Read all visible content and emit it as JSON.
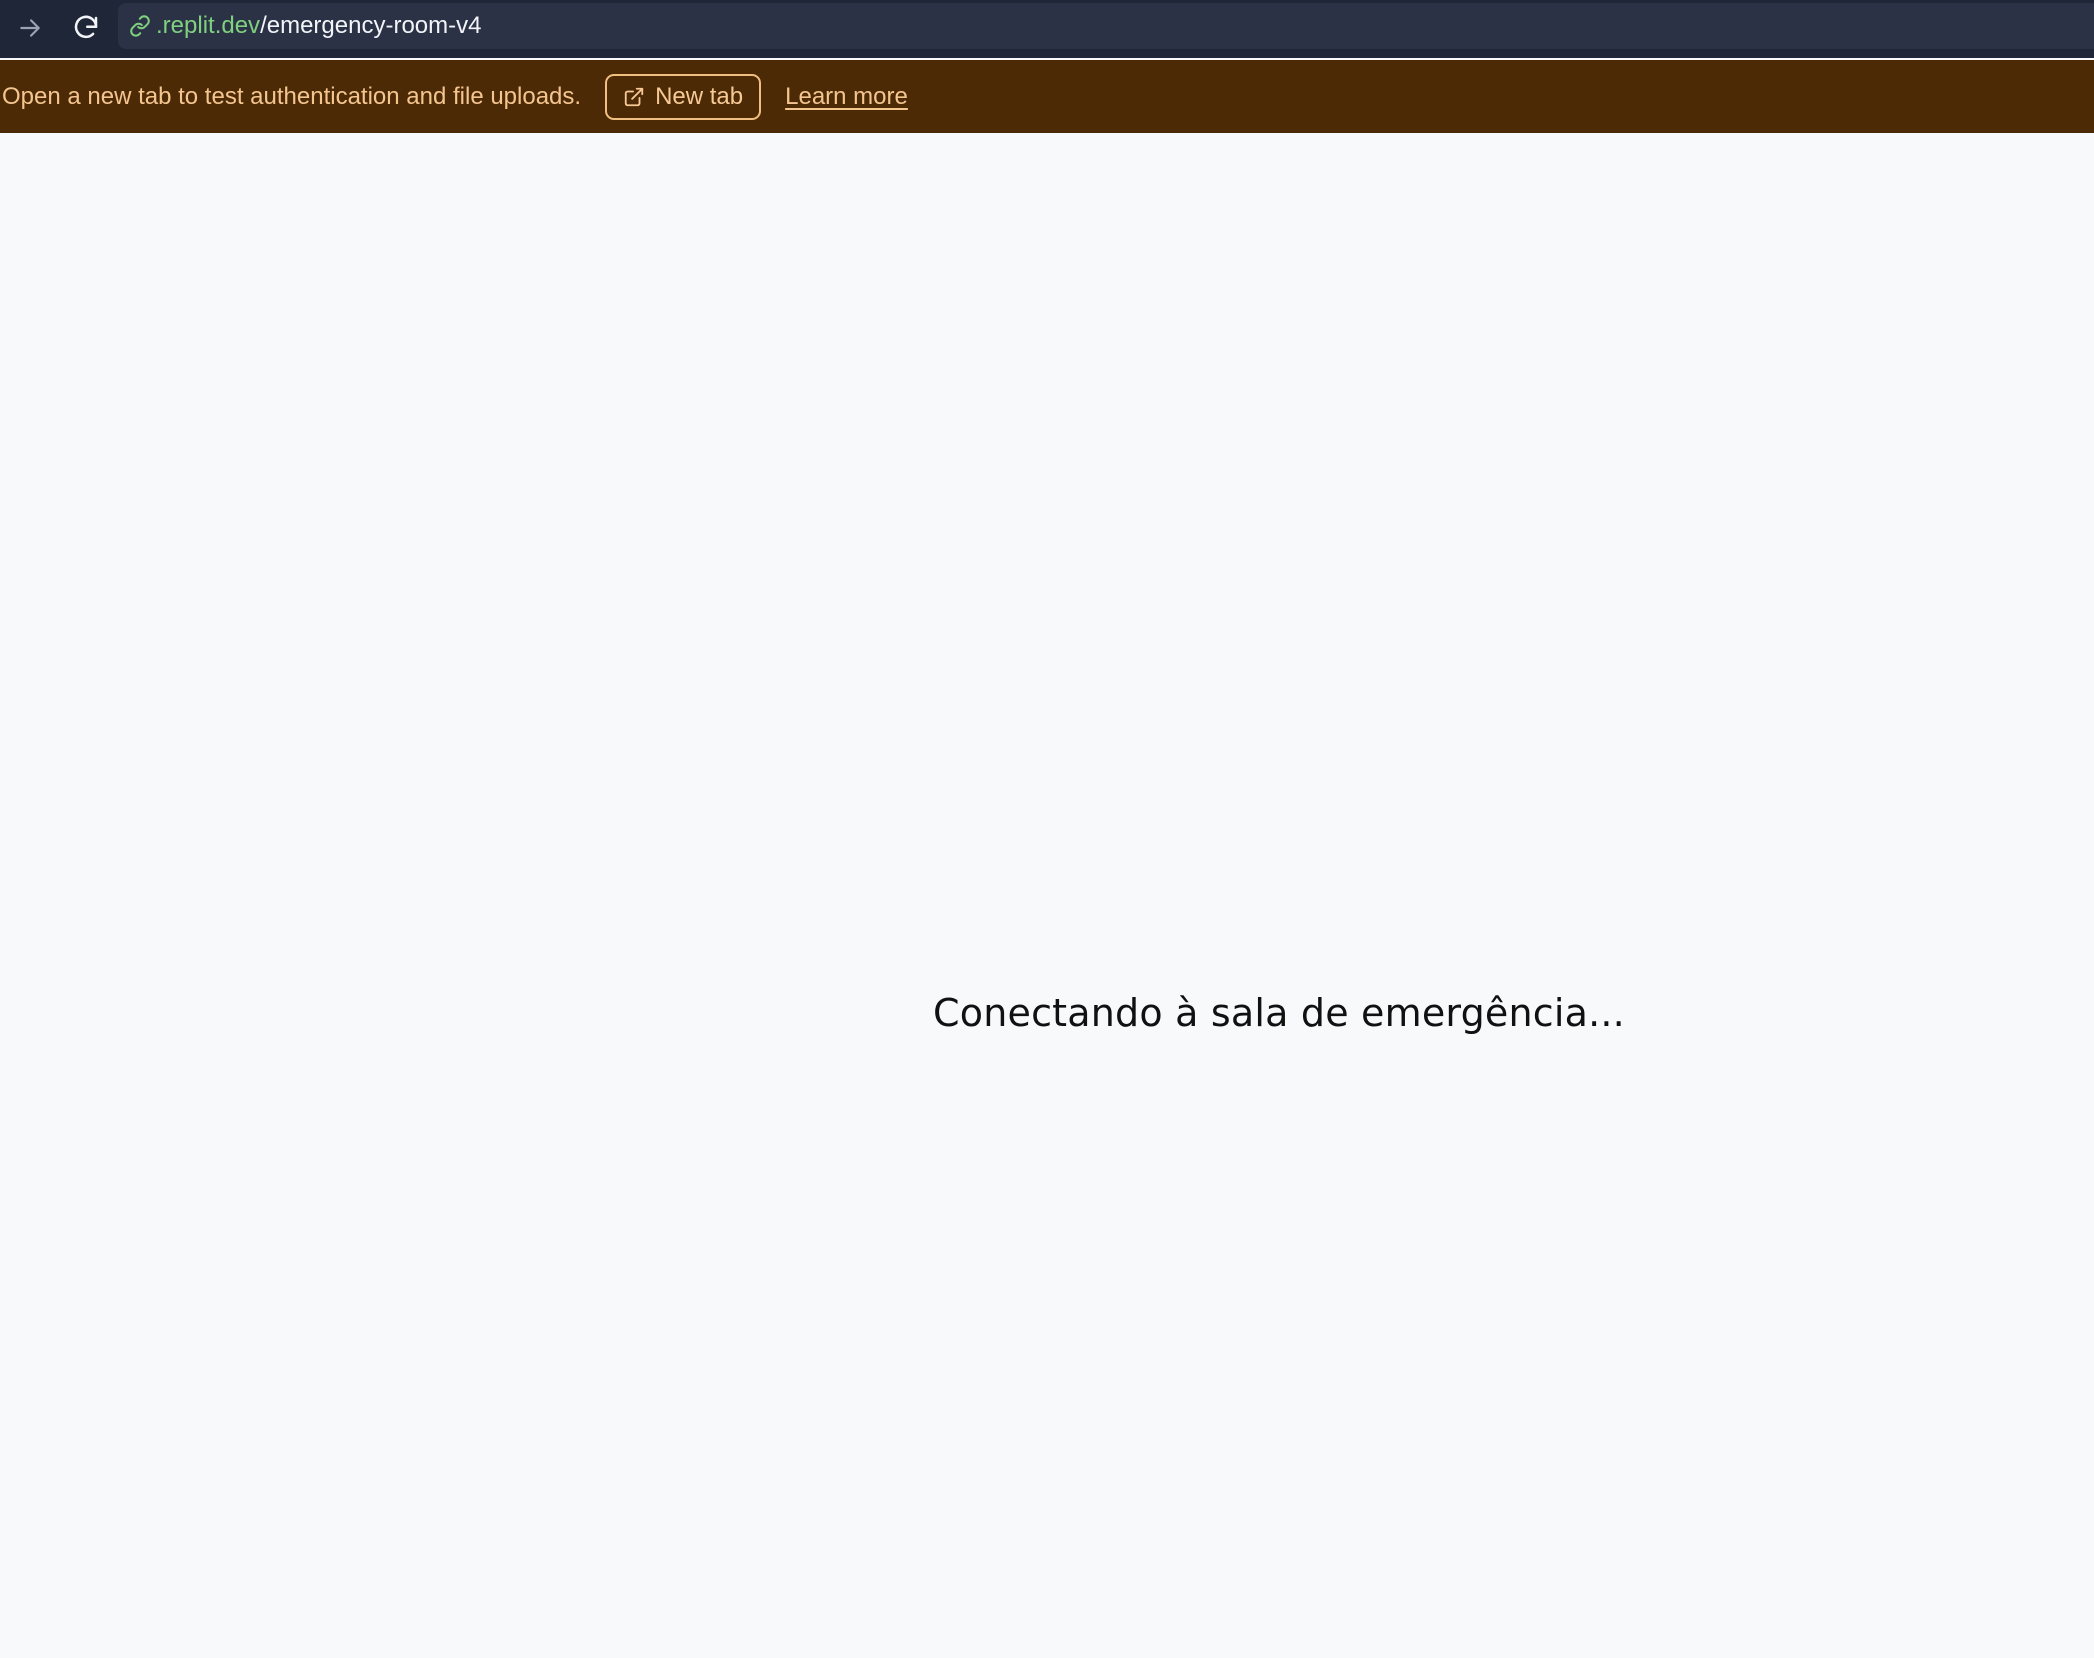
{
  "browser": {
    "url_domain": ".replit.dev",
    "url_path": "/emergency-room-v4",
    "icons": {
      "forward": "arrow-right-icon",
      "reload": "reload-icon",
      "link": "link-icon"
    }
  },
  "banner": {
    "message": "Open a new tab to test authentication and file uploads.",
    "new_tab_label": "New tab",
    "learn_more_label": "Learn more",
    "icons": {
      "new_tab": "external-link-icon"
    }
  },
  "main": {
    "status": "Conectando à sala de emergência..."
  },
  "colors": {
    "addressbar_bg": "#1f2637",
    "url_field_bg": "#2b3246",
    "url_domain": "#7fd07f",
    "banner_bg": "#4d2a06",
    "banner_text": "#f4c58f",
    "page_bg": "#f8f9fb"
  }
}
